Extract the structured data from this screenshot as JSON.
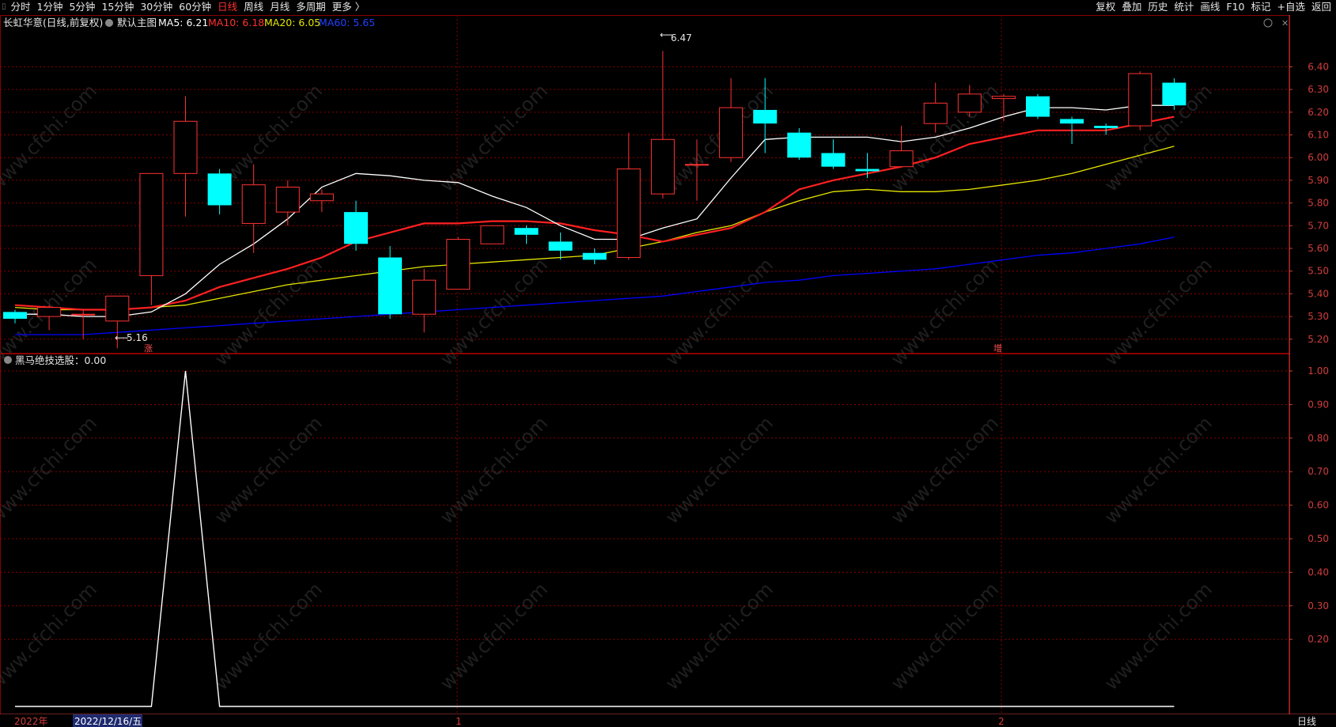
{
  "toolbar": {
    "periods": [
      "分时",
      "1分钟",
      "5分钟",
      "15分钟",
      "30分钟",
      "60分钟",
      "日线",
      "周线",
      "月线",
      "多周期",
      "更多 〉"
    ],
    "active_period": "日线",
    "tools": [
      "复权",
      "叠加",
      "历史",
      "统计",
      "画线",
      "F10",
      "标记",
      "+自选",
      "返回"
    ]
  },
  "main_legend": {
    "stock": "长虹华意(日线,前复权)",
    "main_chart": "默认主图",
    "ma5": "MA5: 6.21",
    "ma10": "MA10: 6.18",
    "ma20": "MA20: 6.05",
    "ma60": "MA60: 5.65"
  },
  "sub_legend": {
    "label": "黑马绝技选股：0.00"
  },
  "annotations": {
    "high": "6.47",
    "low": "5.16",
    "signal1": "涨",
    "signal2": "增"
  },
  "date_bar": {
    "year": "2022年",
    "cursor_date": "2022/12/16/五",
    "month1": "1",
    "month2": "2",
    "period": "日线"
  },
  "watermark": "www.cfchi.com",
  "colors": {
    "up": "#ff3232",
    "down": "#00ffff",
    "ma5": "#ffffff",
    "ma10": "#ff2020",
    "ma20": "#e5e500",
    "ma60": "#0000ff",
    "grid": "#8b0000",
    "axis_text": "#d23c3c",
    "indicator": "#ffffff"
  },
  "chart_data": [
    {
      "type": "candlestick",
      "title": "长虹华意(日线,前复权)",
      "y_ticks": [
        5.2,
        5.3,
        5.4,
        5.5,
        5.6,
        5.7,
        5.8,
        5.9,
        6.0,
        6.1,
        6.2,
        6.3,
        6.4
      ],
      "ylim": [
        5.14,
        6.52
      ],
      "candles": [
        {
          "o": 5.32,
          "c": 5.29,
          "h": 5.33,
          "l": 5.27
        },
        {
          "o": 5.3,
          "c": 5.34,
          "h": 5.35,
          "l": 5.24
        },
        {
          "o": 5.31,
          "c": 5.31,
          "h": 5.33,
          "l": 5.2
        },
        {
          "o": 5.28,
          "c": 5.39,
          "h": 5.39,
          "l": 5.16
        },
        {
          "o": 5.48,
          "c": 5.93,
          "h": 5.93,
          "l": 5.35
        },
        {
          "o": 5.93,
          "c": 6.16,
          "h": 6.27,
          "l": 5.74
        },
        {
          "o": 5.93,
          "c": 5.79,
          "h": 5.95,
          "l": 5.75
        },
        {
          "o": 5.71,
          "c": 5.88,
          "h": 5.97,
          "l": 5.58
        },
        {
          "o": 5.76,
          "c": 5.87,
          "h": 5.9,
          "l": 5.7
        },
        {
          "o": 5.81,
          "c": 5.84,
          "h": 5.86,
          "l": 5.76
        },
        {
          "o": 5.76,
          "c": 5.62,
          "h": 5.81,
          "l": 5.59
        },
        {
          "o": 5.56,
          "c": 5.31,
          "h": 5.61,
          "l": 5.29
        },
        {
          "o": 5.31,
          "c": 5.46,
          "h": 5.51,
          "l": 5.23
        },
        {
          "o": 5.42,
          "c": 5.64,
          "h": 5.65,
          "l": 5.42
        },
        {
          "o": 5.62,
          "c": 5.7,
          "h": 5.7,
          "l": 5.62
        },
        {
          "o": 5.69,
          "c": 5.66,
          "h": 5.7,
          "l": 5.62
        },
        {
          "o": 5.63,
          "c": 5.59,
          "h": 5.67,
          "l": 5.55
        },
        {
          "o": 5.58,
          "c": 5.55,
          "h": 5.6,
          "l": 5.53
        },
        {
          "o": 5.56,
          "c": 5.95,
          "h": 6.11,
          "l": 5.55
        },
        {
          "o": 5.84,
          "c": 6.08,
          "h": 6.47,
          "l": 5.82
        },
        {
          "o": 5.97,
          "c": 5.97,
          "h": 6.08,
          "l": 5.81
        },
        {
          "o": 6.0,
          "c": 6.22,
          "h": 6.35,
          "l": 5.98
        },
        {
          "o": 6.21,
          "c": 6.15,
          "h": 6.35,
          "l": 6.02
        },
        {
          "o": 6.11,
          "c": 6.0,
          "h": 6.13,
          "l": 5.99
        },
        {
          "o": 6.02,
          "c": 5.96,
          "h": 6.08,
          "l": 5.95
        },
        {
          "o": 5.95,
          "c": 5.94,
          "h": 6.02,
          "l": 5.91
        },
        {
          "o": 5.96,
          "c": 6.03,
          "h": 6.14,
          "l": 5.96
        },
        {
          "o": 6.15,
          "c": 6.24,
          "h": 6.33,
          "l": 6.11
        },
        {
          "o": 6.2,
          "c": 6.28,
          "h": 6.32,
          "l": 6.18
        },
        {
          "o": 6.26,
          "c": 6.27,
          "h": 6.28,
          "l": 6.16
        },
        {
          "o": 6.27,
          "c": 6.18,
          "h": 6.28,
          "l": 6.17
        },
        {
          "o": 6.17,
          "c": 6.15,
          "h": 6.18,
          "l": 6.06
        },
        {
          "o": 6.14,
          "c": 6.13,
          "h": 6.15,
          "l": 6.1
        },
        {
          "o": 6.14,
          "c": 6.37,
          "h": 6.38,
          "l": 6.12
        },
        {
          "o": 6.33,
          "c": 6.23,
          "h": 6.35,
          "l": 6.21
        }
      ],
      "ma5": [
        5.31,
        5.31,
        5.3,
        5.3,
        5.32,
        5.4,
        5.53,
        5.62,
        5.73,
        5.87,
        5.93,
        5.92,
        5.9,
        5.89,
        5.83,
        5.78,
        5.7,
        5.64,
        5.64,
        5.69,
        5.73,
        5.91,
        6.08,
        6.09,
        6.09,
        6.09,
        6.07,
        6.09,
        6.13,
        6.18,
        6.22,
        6.22,
        6.21,
        6.23,
        6.23
      ],
      "ma10": [
        5.35,
        5.34,
        5.33,
        5.33,
        5.34,
        5.37,
        5.43,
        5.47,
        5.51,
        5.56,
        5.63,
        5.67,
        5.71,
        5.71,
        5.72,
        5.72,
        5.71,
        5.68,
        5.66,
        5.63,
        5.66,
        5.69,
        5.76,
        5.86,
        5.9,
        5.93,
        5.96,
        6.0,
        6.06,
        6.09,
        6.12,
        6.12,
        6.12,
        6.15,
        6.18
      ],
      "ma20": [
        5.34,
        5.33,
        5.33,
        5.33,
        5.34,
        5.35,
        5.38,
        5.41,
        5.44,
        5.46,
        5.48,
        5.5,
        5.52,
        5.53,
        5.54,
        5.55,
        5.56,
        5.57,
        5.6,
        5.63,
        5.67,
        5.7,
        5.76,
        5.81,
        5.85,
        5.86,
        5.85,
        5.85,
        5.86,
        5.88,
        5.9,
        5.93,
        5.97,
        6.01,
        6.05
      ],
      "ma60": [
        5.22,
        5.22,
        5.22,
        5.23,
        5.24,
        5.25,
        5.26,
        5.27,
        5.28,
        5.29,
        5.3,
        5.31,
        5.32,
        5.33,
        5.34,
        5.35,
        5.36,
        5.37,
        5.38,
        5.39,
        5.41,
        5.43,
        5.45,
        5.46,
        5.48,
        5.49,
        5.5,
        5.51,
        5.53,
        5.55,
        5.57,
        5.58,
        5.6,
        5.62,
        5.65
      ]
    },
    {
      "type": "line",
      "title": "黑马绝技选股",
      "y_ticks": [
        0.2,
        0.3,
        0.4,
        0.5,
        0.6,
        0.7,
        0.8,
        0.9,
        1.0
      ],
      "ylim": [
        0,
        1
      ],
      "series": [
        {
          "name": "黑马绝技选股",
          "values": [
            0,
            0,
            0,
            0,
            0,
            1,
            0,
            0,
            0,
            0,
            0,
            0,
            0,
            0,
            0,
            0,
            0,
            0,
            0,
            0,
            0,
            0,
            0,
            0,
            0,
            0,
            0,
            0,
            0,
            0,
            0,
            0,
            0,
            0,
            0
          ]
        }
      ]
    }
  ]
}
